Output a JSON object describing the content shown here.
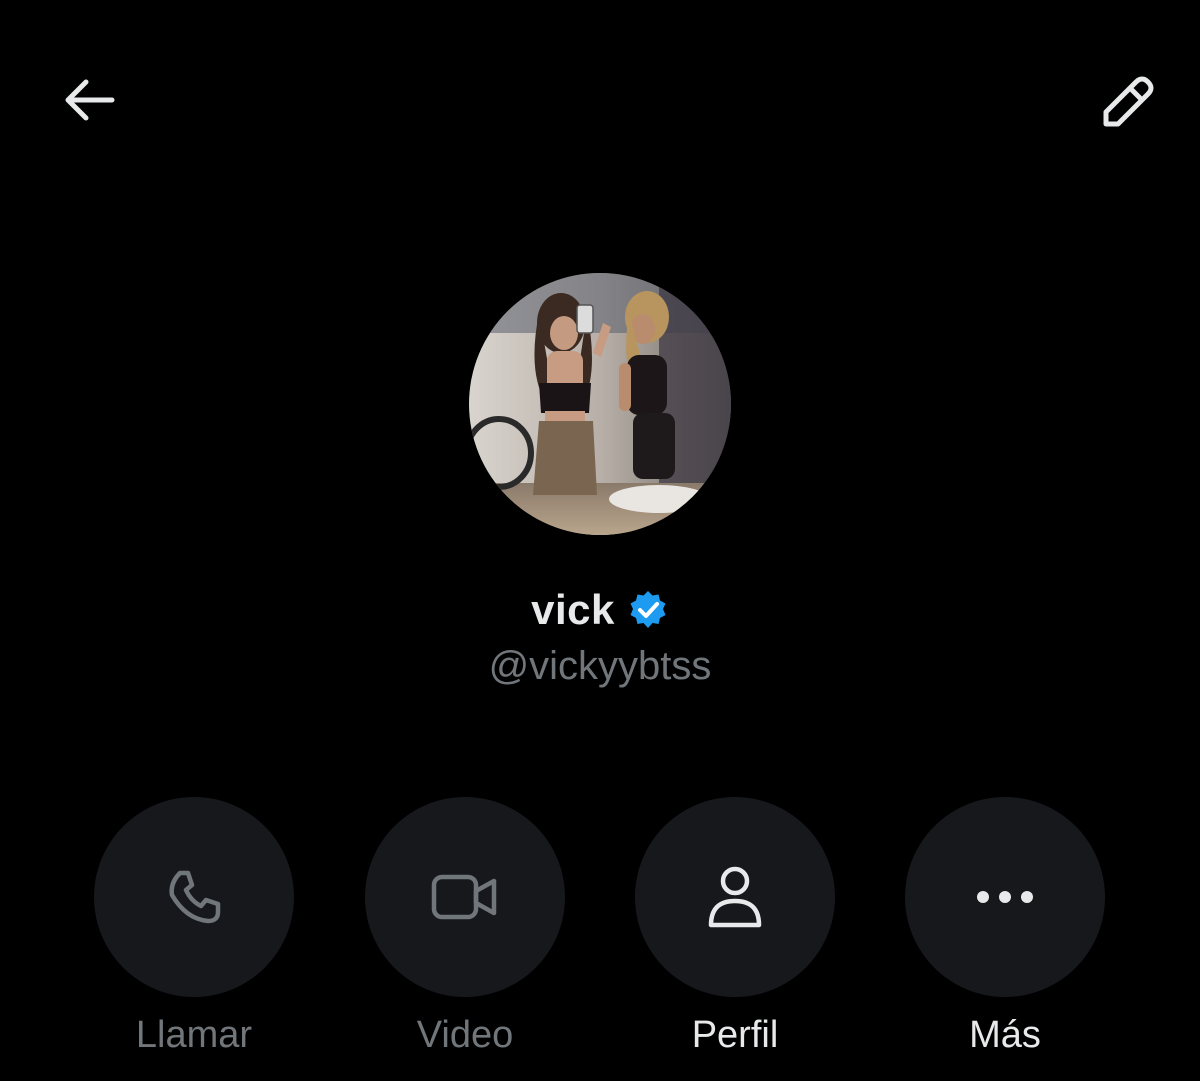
{
  "header": {
    "back_icon": "arrow-left-icon",
    "edit_icon": "pencil-icon"
  },
  "profile": {
    "display_name": "vick",
    "handle": "@vickyybtss",
    "verified": true,
    "verified_color": "#1d9bf0",
    "avatar": "mirror-selfie-photo"
  },
  "actions": [
    {
      "label": "Llamar",
      "icon": "phone-icon",
      "enabled": false
    },
    {
      "label": "Video",
      "icon": "video-camera-icon",
      "enabled": false
    },
    {
      "label": "Perfil",
      "icon": "person-icon",
      "enabled": true
    },
    {
      "label": "Más",
      "icon": "more-dots-icon",
      "enabled": true
    }
  ],
  "colors": {
    "background": "#000000",
    "button_bg": "#16181c",
    "text_primary": "#e7e9ea",
    "text_secondary": "#71767b"
  }
}
